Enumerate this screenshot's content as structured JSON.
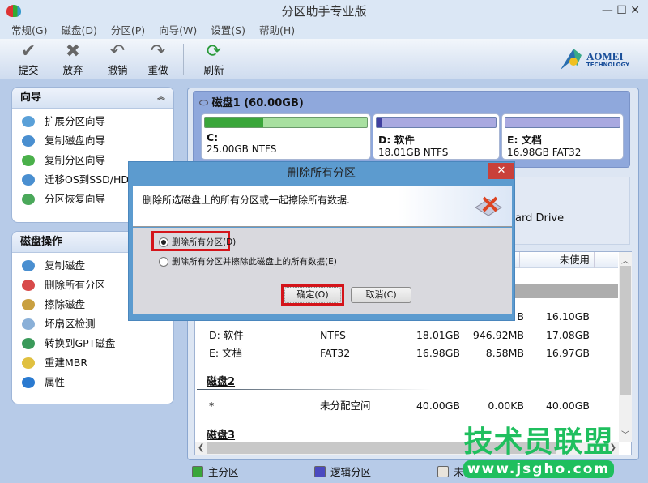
{
  "window": {
    "title": "分区助手专业版",
    "controls": "—   ☐   ✕"
  },
  "menu": [
    "常规(G)",
    "磁盘(D)",
    "分区(P)",
    "向导(W)",
    "设置(S)",
    "帮助(H)"
  ],
  "toolbar": [
    {
      "label": "提交",
      "icon": "check-icon"
    },
    {
      "label": "放弃",
      "icon": "x-icon"
    },
    {
      "label": "撤销",
      "icon": "undo-icon"
    },
    {
      "label": "重做",
      "icon": "redo-icon"
    },
    {
      "label": "刷新",
      "icon": "refresh-icon"
    }
  ],
  "logo": {
    "name": "AOMEI",
    "sub": "TECHNOLOGY"
  },
  "sidebar": {
    "wizard": {
      "title": "向导",
      "items": [
        "扩展分区向导",
        "复制磁盘向导",
        "复制分区向导",
        "迁移OS到SSD/HDD",
        "分区恢复向导"
      ]
    },
    "disk_ops": {
      "title": "磁盘操作",
      "items": [
        "复制磁盘",
        "删除所有分区",
        "擦除磁盘",
        "坏扇区检测",
        "转换到GPT磁盘",
        "重建MBR",
        "属性"
      ]
    }
  },
  "disk": {
    "title": "磁盘1 (60.00GB)",
    "info_text": "ard Drive",
    "partitions": [
      {
        "name": "C:",
        "info": "25.00GB NTFS",
        "used_fraction": 0.36,
        "color": "#3aa63a"
      },
      {
        "name": "D: 软件",
        "info": "18.01GB NTFS",
        "used_fraction": 0.05,
        "color": "#4040a0"
      },
      {
        "name": "E: 文档",
        "info": "16.98GB FAT32",
        "used_fraction": 0.0,
        "color": "#4040a0"
      }
    ]
  },
  "table": {
    "headers": {
      "used_partial": "用",
      "unused": "未使用"
    },
    "rows_disk1": [
      {
        "name": "",
        "type": "",
        "capacity": "",
        "used": "B",
        "unused": "16.10GB"
      },
      {
        "name": "D: 软件",
        "type": "NTFS",
        "capacity": "18.01GB",
        "used": "946.92MB",
        "unused": "17.08GB"
      },
      {
        "name": "E: 文档",
        "type": "FAT32",
        "capacity": "16.98GB",
        "used": "8.58MB",
        "unused": "16.97GB"
      }
    ],
    "disk2": "磁盘2",
    "rows_disk2": [
      {
        "name": "*",
        "type": "未分配空间",
        "capacity": "40.00GB",
        "used": "0.00KB",
        "unused": "40.00GB"
      }
    ],
    "disk3": "磁盘3"
  },
  "legend": [
    {
      "label": "主分区",
      "color": "#3aa63a"
    },
    {
      "label": "逻辑分区",
      "color": "#4a4ac0"
    },
    {
      "label": "未",
      "color": "#e8e4dc"
    }
  ],
  "dialog": {
    "title": "删除所有分区",
    "message": "删除所选磁盘上的所有分区或一起擦除所有数据.",
    "option1": "删除所有分区(D)",
    "option2": "删除所有分区并擦除此磁盘上的所有数据(E)",
    "selected": "option1",
    "ok": "确定(O)",
    "cancel": "取消(C)"
  },
  "watermark": {
    "title": "技术员联盟",
    "url": "www.jsgho.com"
  }
}
